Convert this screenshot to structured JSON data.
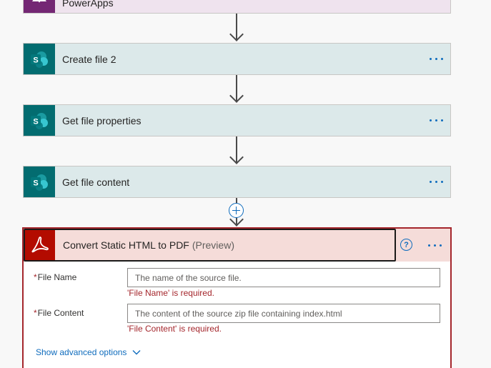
{
  "colors": {
    "accent": "#0f6cbd",
    "sharepoint": "#036c70",
    "powerapps": "#742774",
    "adobe_red": "#b30b00",
    "error": "#a4262c"
  },
  "steps": [
    {
      "title": "PowerApps",
      "icon": "powerapps-icon"
    },
    {
      "title": "Create file 2",
      "icon": "sharepoint-icon"
    },
    {
      "title": "Get file properties",
      "icon": "sharepoint-icon"
    },
    {
      "title": "Get file content",
      "icon": "sharepoint-icon"
    }
  ],
  "action": {
    "title": "Convert Static HTML to PDF",
    "preview": "(Preview)",
    "icon": "adobe-acrobat-icon",
    "fields": [
      {
        "required_mark": "*",
        "label": "File Name",
        "placeholder": "The name of the source file.",
        "value": "",
        "error": "'File Name' is required."
      },
      {
        "required_mark": "*",
        "label": "File Content",
        "placeholder": "The content of the source zip file containing index.html",
        "value": "",
        "error": "'File Content' is required."
      }
    ],
    "advanced_options": "Show advanced options"
  }
}
